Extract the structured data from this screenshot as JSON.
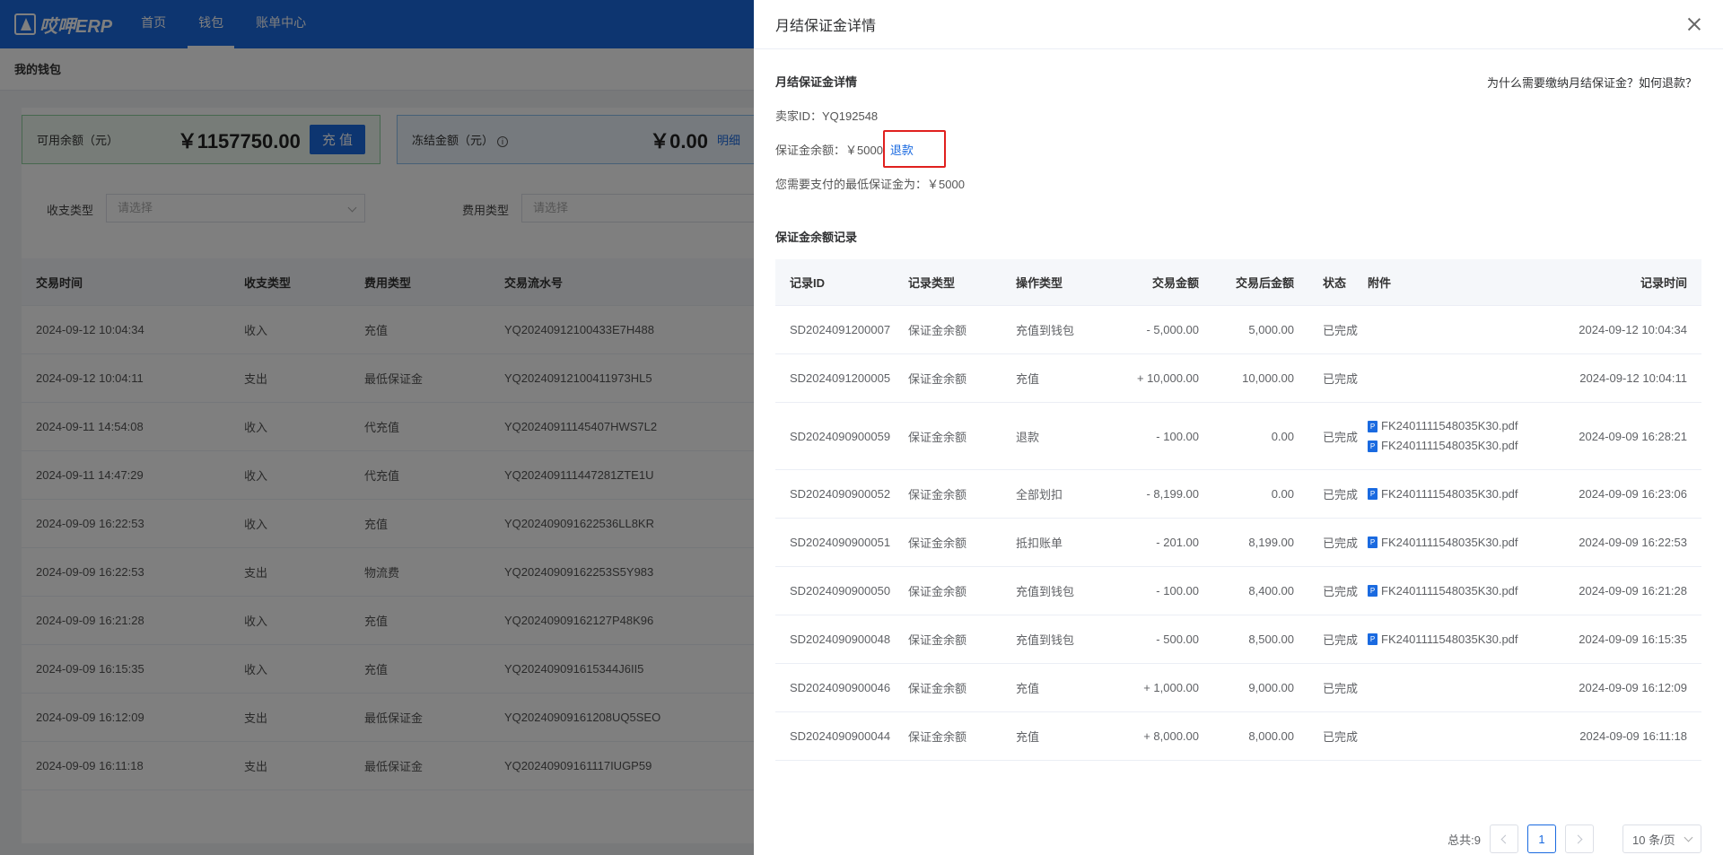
{
  "topbar": {
    "logo_text": "哎呷ERP",
    "nav": [
      "首页",
      "钱包",
      "账单中心"
    ],
    "active_nav": "钱包"
  },
  "breadcrumb": "我的钱包",
  "wallet": {
    "available_label": "可用余额（元）",
    "available_amount": "￥1157750.00",
    "recharge_label": "充 值",
    "frozen_label": "冻结金额（元）",
    "frozen_amount": "￥0.00",
    "detail_label": "明细"
  },
  "filters": {
    "type_label": "收支类型",
    "type_placeholder": "请选择",
    "fee_label": "费用类型",
    "fee_placeholder": "请选择"
  },
  "bg_table": {
    "headers": [
      "交易时间",
      "收支类型",
      "费用类型",
      "交易流水号"
    ],
    "rows": [
      [
        "2024-09-12 10:04:34",
        "收入",
        "充值",
        "YQ20240912100433E7H488"
      ],
      [
        "2024-09-12 10:04:11",
        "支出",
        "最低保证金",
        "YQ20240912100411973HL5"
      ],
      [
        "2024-09-11 14:54:08",
        "收入",
        "代充值",
        "YQ20240911145407HWS7L2"
      ],
      [
        "2024-09-11 14:47:29",
        "收入",
        "代充值",
        "YQ202409111447281ZTE1U"
      ],
      [
        "2024-09-09 16:22:53",
        "收入",
        "充值",
        "YQ202409091622536LL8KR"
      ],
      [
        "2024-09-09 16:22:53",
        "支出",
        "物流费",
        "YQ20240909162253S5Y983"
      ],
      [
        "2024-09-09 16:21:28",
        "收入",
        "充值",
        "YQ20240909162127P48K96"
      ],
      [
        "2024-09-09 16:15:35",
        "收入",
        "充值",
        "YQ202409091615344J6II5"
      ],
      [
        "2024-09-09 16:12:09",
        "支出",
        "最低保证金",
        "YQ20240909161208UQ5SEO"
      ],
      [
        "2024-09-09 16:11:18",
        "支出",
        "最低保证金",
        "YQ20240909161117IUGP59"
      ]
    ]
  },
  "drawer": {
    "title": "月结保证金详情",
    "section_title": "月结保证金详情",
    "help_link": "为什么需要缴纳月结保证金？如何退款？",
    "seller_id": "卖家ID：YQ192548",
    "balance_text": "保证金余额：￥5000",
    "refund_label": "退款",
    "min_deposit": "您需要支付的最低保证金为：￥5000",
    "records_title": "保证金余额记录",
    "table_headers": [
      "记录ID",
      "记录类型",
      "操作类型",
      "交易金额",
      "交易后金额",
      "状态",
      "附件",
      "记录时间"
    ],
    "records": [
      {
        "id": "SD2024091200007",
        "type": "保证金余额",
        "op": "充值到钱包",
        "amount": "- 5,000.00",
        "after": "5,000.00",
        "status": "已完成",
        "files": [],
        "time": "2024-09-12 10:04:34"
      },
      {
        "id": "SD2024091200005",
        "type": "保证金余额",
        "op": "充值",
        "amount": "+ 10,000.00",
        "after": "10,000.00",
        "status": "已完成",
        "files": [],
        "time": "2024-09-12 10:04:11"
      },
      {
        "id": "SD2024090900059",
        "type": "保证金余额",
        "op": "退款",
        "amount": "- 100.00",
        "after": "0.00",
        "status": "已完成",
        "files": [
          "FK2401111548035K30.pdf",
          "FK2401111548035K30.pdf"
        ],
        "time": "2024-09-09 16:28:21"
      },
      {
        "id": "SD2024090900052",
        "type": "保证金余额",
        "op": "全部划扣",
        "amount": "- 8,199.00",
        "after": "0.00",
        "status": "已完成",
        "files": [
          "FK2401111548035K30.pdf"
        ],
        "time": "2024-09-09 16:23:06"
      },
      {
        "id": "SD2024090900051",
        "type": "保证金余额",
        "op": "抵扣账单",
        "amount": "- 201.00",
        "after": "8,199.00",
        "status": "已完成",
        "files": [
          "FK2401111548035K30.pdf"
        ],
        "time": "2024-09-09 16:22:53"
      },
      {
        "id": "SD2024090900050",
        "type": "保证金余额",
        "op": "充值到钱包",
        "amount": "- 100.00",
        "after": "8,400.00",
        "status": "已完成",
        "files": [
          "FK2401111548035K30.pdf"
        ],
        "time": "2024-09-09 16:21:28"
      },
      {
        "id": "SD2024090900048",
        "type": "保证金余额",
        "op": "充值到钱包",
        "amount": "- 500.00",
        "after": "8,500.00",
        "status": "已完成",
        "files": [
          "FK2401111548035K30.pdf"
        ],
        "time": "2024-09-09 16:15:35"
      },
      {
        "id": "SD2024090900046",
        "type": "保证金余额",
        "op": "充值",
        "amount": "+ 1,000.00",
        "after": "9,000.00",
        "status": "已完成",
        "files": [],
        "time": "2024-09-09 16:12:09"
      },
      {
        "id": "SD2024090900044",
        "type": "保证金余额",
        "op": "充值",
        "amount": "+ 8,000.00",
        "after": "8,000.00",
        "status": "已完成",
        "files": [],
        "time": "2024-09-09 16:11:18"
      }
    ],
    "pagination": {
      "total": "总共:9",
      "current_page": "1",
      "page_size": "10 条/页"
    }
  },
  "colors": {
    "brand": "#1a6ae0",
    "highlight_box": "#e0201e"
  }
}
